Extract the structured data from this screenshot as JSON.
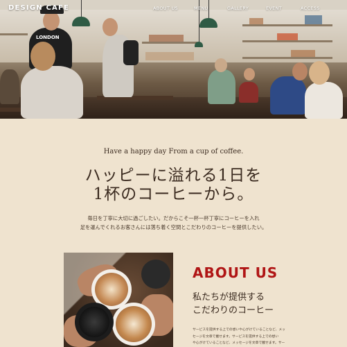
{
  "brand": {
    "logo": "DESIGN CAFE"
  },
  "nav": {
    "items": [
      "ABOUT US",
      "MENU",
      "GALLERY",
      "EVENT",
      "ACCESS"
    ]
  },
  "intro": {
    "tagline": "Have a happy day From a cup of coffee.",
    "headline_line1": "ハッピーに溢れる1日を",
    "headline_line2": "1杯のコーヒーから。",
    "body_line1": "毎日を丁寧に大切に過ごしたい。だからこそ一杯一杯丁寧にコーヒーを入れ",
    "body_line2": "足を運んでくれるお客さんには落ち着く空間とこだわりのコーヒーを提供したい。"
  },
  "about": {
    "title": "ABOUT US",
    "subtitle_line1": "私たちが提供する",
    "subtitle_line2": "こだわりのコーヒー",
    "body_line1": "サービスを提供する上での想いや心がけていることなど、メッ",
    "body_line2": "セージを文章で載せます。サービスを提供する上での想い",
    "body_line3": "や心がけていることなど、メッセージを文章で載せます。サー"
  },
  "colors": {
    "accent": "#b01515",
    "background": "#efe3cf",
    "text": "#3a2a1f"
  }
}
